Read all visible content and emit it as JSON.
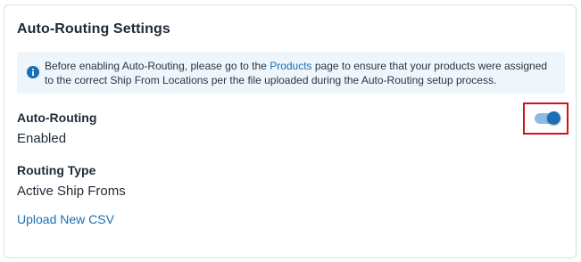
{
  "card": {
    "title": "Auto-Routing Settings"
  },
  "info": {
    "icon": "info-circle-icon",
    "text_before": "Before enabling Auto-Routing, please go to the ",
    "link_text": "Products",
    "text_after": " page to ensure that your products were assigned to the correct Ship From Locations per the file uploaded during the Auto-Routing setup process."
  },
  "auto_routing": {
    "label": "Auto-Routing",
    "value": "Enabled",
    "toggle_on": true
  },
  "routing_type": {
    "label": "Routing Type",
    "value": "Active Ship Froms"
  },
  "upload": {
    "label": "Upload New CSV"
  },
  "colors": {
    "accent": "#1a6fb5",
    "toggle_track": "#8dbbe6",
    "highlight_border": "#d0141c",
    "info_background": "#eef5fb"
  }
}
